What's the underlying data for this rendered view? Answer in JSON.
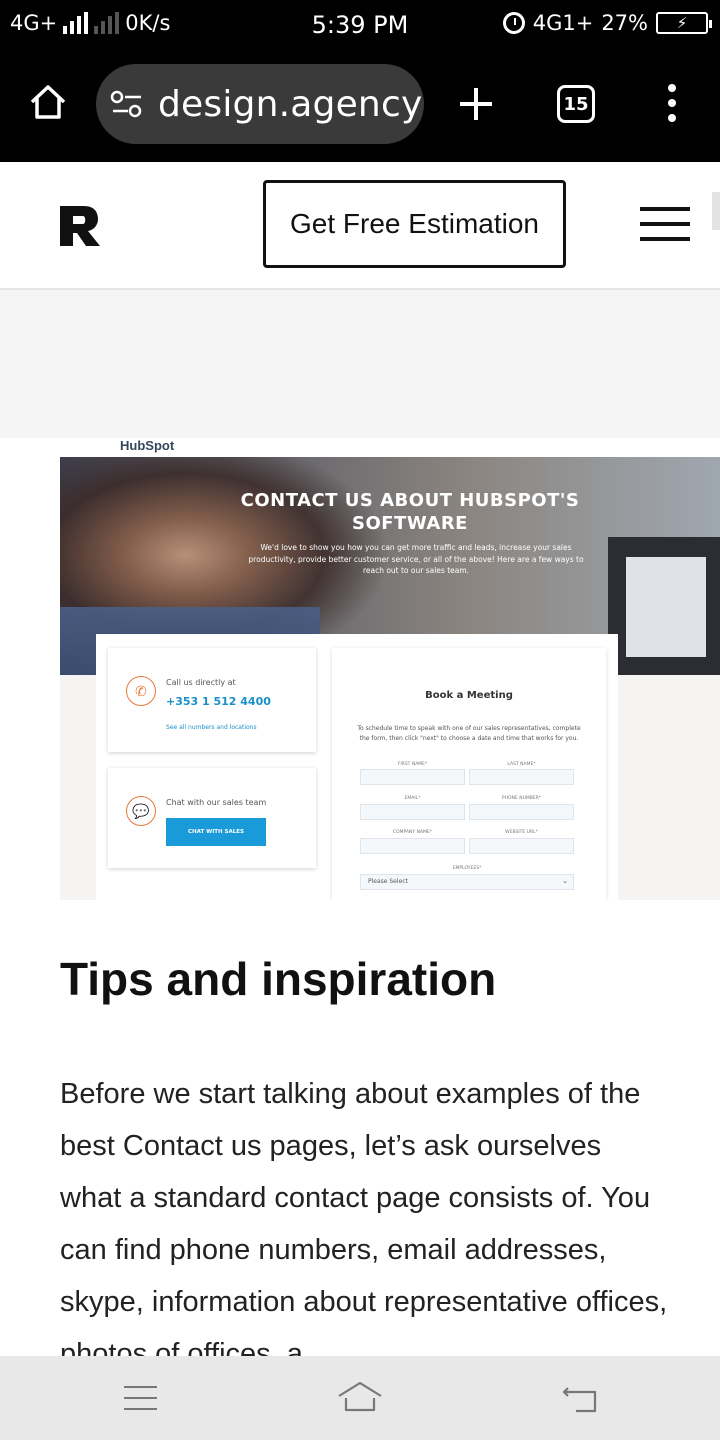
{
  "status_bar": {
    "network_label": "4G+",
    "speed": "0K/s",
    "time": "5:39 PM",
    "network_right": "4G1+",
    "battery_percent": "27%"
  },
  "browser": {
    "url": "design.agency",
    "tab_count": "15",
    "icons": [
      "home-icon",
      "site-settings-icon",
      "new-tab-plus-icon",
      "tab-switcher-icon",
      "more-options-icon"
    ]
  },
  "site_header": {
    "cta_label": "Get Free Estimation",
    "logo_icon": "r-logo-icon",
    "menu_icon": "hamburger-menu-icon"
  },
  "embedded_screenshot": {
    "brand": "HubSpot",
    "hero_title": "CONTACT US ABOUT HUBSPOT'S SOFTWARE",
    "hero_subtitle": "We'd love to show you how you can get more traffic and leads, increase your sales productivity, provide better customer service, or all of the above! Here are a few ways to reach out to our sales team.",
    "call": {
      "label": "Call us directly at",
      "number": "+353 1 512 4400",
      "link": "See all numbers and locations"
    },
    "chat": {
      "label": "Chat with our sales team",
      "button": "CHAT WITH SALES"
    },
    "meeting": {
      "title": "Book a Meeting",
      "description": "To schedule time to speak with one of our sales representatives, complete the form, then click \"next\" to choose a date and time that works for you.",
      "fields": [
        "FIRST NAME*",
        "LAST NAME*",
        "EMAIL*",
        "PHONE NUMBER*",
        "COMPANY NAME*",
        "WEBSITE URL*"
      ],
      "employees_label": "EMPLOYEES*",
      "employees_select": "Please Select"
    }
  },
  "article": {
    "title": "Tips and inspiration",
    "body": "Before we start talking about examples of the best Contact us pages, let’s ask ourselves what a standard contact page consists of. You can find phone numbers, email addresses, skype, information about representative offices, photos of offices, a"
  },
  "colors": {
    "accent_blue": "#1a9ad9",
    "hubspot_orange": "#e8773a",
    "bar_black": "#000000"
  }
}
